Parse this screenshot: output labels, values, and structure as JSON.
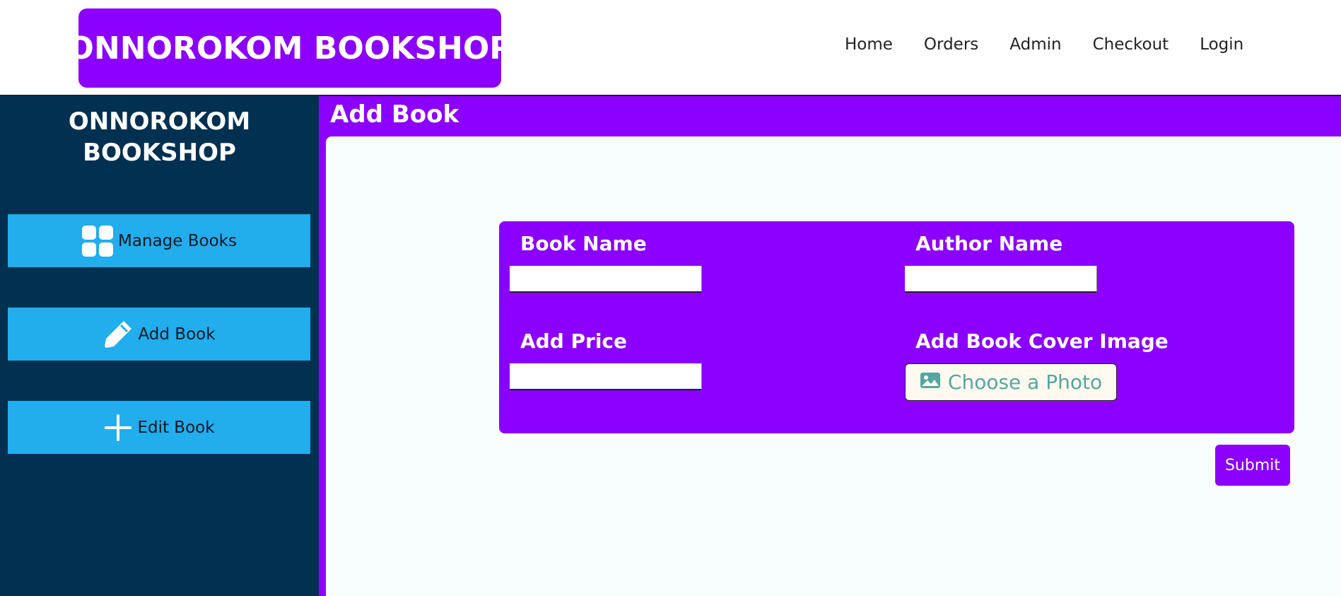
{
  "navbar": {
    "brand": "ONNOROKOM BOOKSHOP",
    "links": [
      "Home",
      "Orders",
      "Admin",
      "Checkout",
      "Login"
    ]
  },
  "sidebar": {
    "title_line1": "ONNOROKOM",
    "title_line2": "BOOKSHOP",
    "items": [
      {
        "label": "Manage Books",
        "icon": "grid-icon"
      },
      {
        "label": "Add Book",
        "icon": "pencil-icon"
      },
      {
        "label": "Edit Book",
        "icon": "plus-icon"
      }
    ]
  },
  "main": {
    "title": "Add Book",
    "form": {
      "book_name_label": "Book Name",
      "book_name_value": "",
      "author_name_label": "Author Name",
      "author_name_value": "",
      "price_label": "Add Price",
      "price_value": "",
      "cover_label": "Add Book Cover Image",
      "photo_button": "Choose a Photo",
      "submit": "Submit"
    }
  },
  "colors": {
    "accent": "#8b00ff",
    "sidebar_bg": "#013050",
    "sidebar_button": "#22aded",
    "panel_bg": "#f8fdfd",
    "photo_text": "#56a6a0"
  }
}
